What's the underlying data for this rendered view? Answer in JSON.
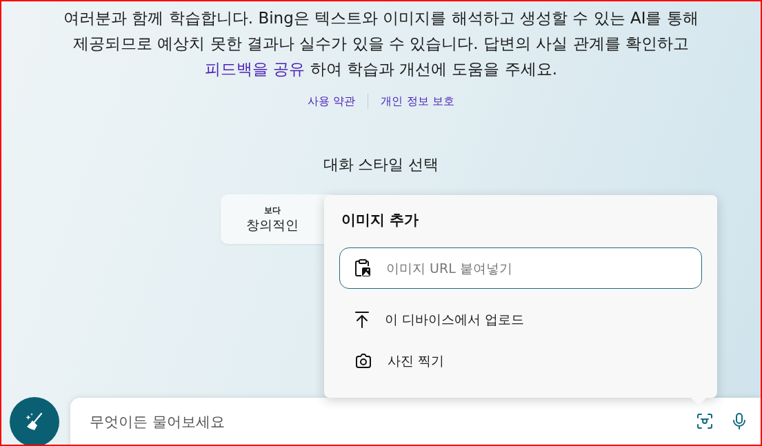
{
  "notice": {
    "text_before": "여러분과 함께 학습합니다. Bing은 텍스트와 이미지를 해석하고 생성할 수 있는 AI를 통해 제공되므로 예상치 못한 결과나 실수가 있을 수 있습니다. 답변의 사실 관계를 확인하고",
    "link": "피드백을 공유",
    "text_after": " 하여 학습과 개선에 도움을 주세요."
  },
  "legal_links": [
    "사용 약관",
    "개인 정보 보호"
  ],
  "conversation_style": {
    "title": "대화 스타일 선택",
    "options": [
      {
        "top": "보다",
        "label": "창의적인"
      }
    ]
  },
  "add_image_popup": {
    "title": "이미지 추가",
    "url_field": {
      "placeholder": "이미지 URL 붙여넣기"
    },
    "items": [
      {
        "kind": "upload",
        "label": "이 디바이스에서 업로드"
      },
      {
        "kind": "camera",
        "label": "사진 찍기"
      }
    ]
  },
  "chat_input": {
    "placeholder": "무엇이든 물어보세요"
  }
}
